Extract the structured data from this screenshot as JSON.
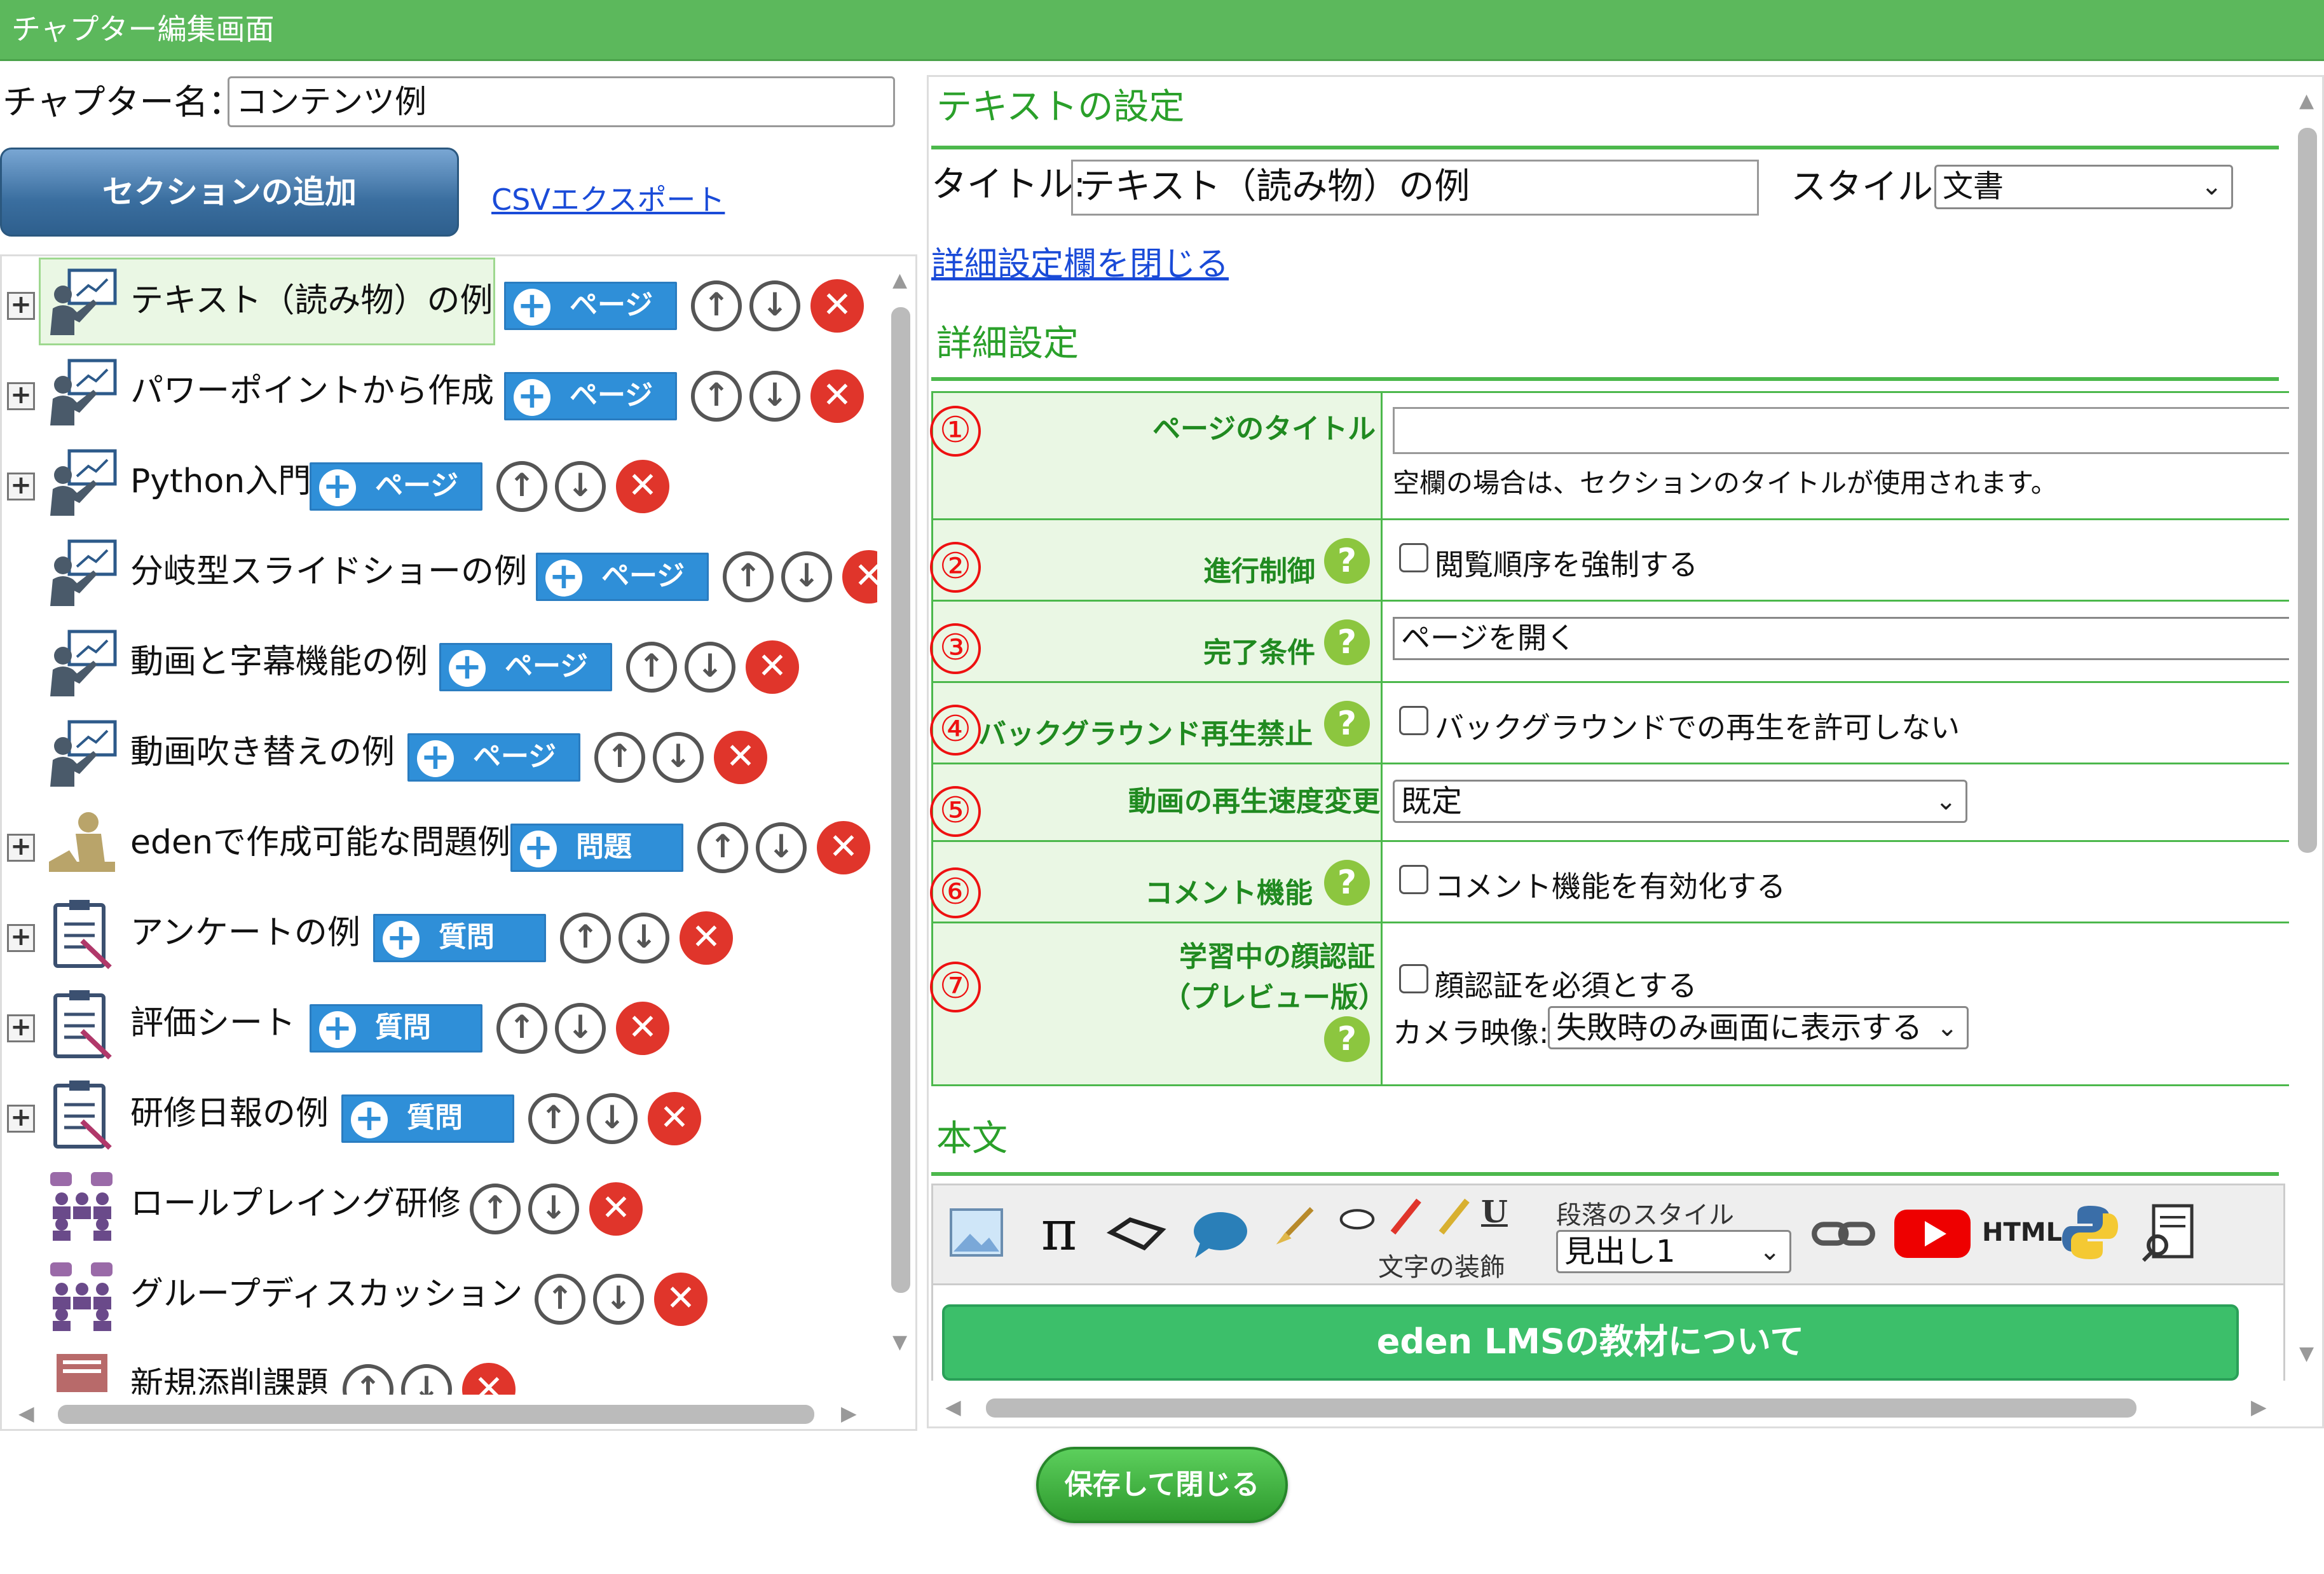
{
  "window_title": "チャプター編集画面",
  "chapter": {
    "label": "チャプター名：",
    "value": "コンテンツ例"
  },
  "toolbar": {
    "add_section_label": "セクションの追加",
    "csv_export_label": "CSVエクスポート"
  },
  "sections": [
    {
      "label": "テキスト（読み物）の例",
      "button": "ページ",
      "icon": "presentation-icon",
      "expandable": true,
      "selected": true,
      "has_button": true
    },
    {
      "label": "パワーポイントから作成",
      "button": "ページ",
      "icon": "presentation-icon",
      "expandable": true,
      "selected": false,
      "has_button": true
    },
    {
      "label": "Python入門",
      "button": "ページ",
      "icon": "presentation-icon",
      "expandable": true,
      "selected": false,
      "has_button": true
    },
    {
      "label": "分岐型スライドショーの例",
      "button": "ページ",
      "icon": "presentation-icon",
      "expandable": false,
      "selected": false,
      "has_button": true
    },
    {
      "label": "動画と字幕機能の例",
      "button": "ページ",
      "icon": "presentation-icon",
      "expandable": false,
      "selected": false,
      "has_button": true
    },
    {
      "label": "動画吹き替えの例",
      "button": "ページ",
      "icon": "presentation-icon",
      "expandable": false,
      "selected": false,
      "has_button": true
    },
    {
      "label": "edenで作成可能な問題例",
      "button": "問題",
      "icon": "exam-icon",
      "expandable": true,
      "selected": false,
      "has_button": true
    },
    {
      "label": "アンケートの例",
      "button": "質問",
      "icon": "clipboard-icon",
      "expandable": true,
      "selected": false,
      "has_button": true
    },
    {
      "label": "評価シート",
      "button": "質問",
      "icon": "clipboard-icon",
      "expandable": true,
      "selected": false,
      "has_button": true
    },
    {
      "label": "研修日報の例",
      "button": "質問",
      "icon": "clipboard-icon",
      "expandable": true,
      "selected": false,
      "has_button": true
    },
    {
      "label": "ロールプレイング研修",
      "button": "",
      "icon": "group-icon",
      "expandable": false,
      "selected": false,
      "has_button": false
    },
    {
      "label": "グループディスカッション",
      "button": "",
      "icon": "group-icon",
      "expandable": false,
      "selected": false,
      "has_button": false
    },
    {
      "label": "新規添削課題",
      "button": "",
      "icon": "report-icon",
      "expandable": false,
      "selected": false,
      "has_button": false
    }
  ],
  "text_settings": {
    "heading": "テキストの設定",
    "title_label": "タイトル:",
    "title_value": "テキスト（読み物）の例",
    "style_label": "スタイル:",
    "style_value": "文書",
    "close_detail_link": "詳細設定欄を閉じる"
  },
  "detail": {
    "heading": "詳細設定",
    "rows": [
      {
        "num": "①",
        "label": "ページのタイトル",
        "help": false,
        "note": "空欄の場合は、セクションのタイトルが使用されます。"
      },
      {
        "num": "②",
        "label": "進行制御",
        "help": true,
        "checkbox": "閲覧順序を強制する"
      },
      {
        "num": "③",
        "label": "完了条件",
        "help": true,
        "value": "ページを開く"
      },
      {
        "num": "④",
        "label": "バックグラウンド再生禁止",
        "help": true,
        "checkbox": "バックグラウンドでの再生を許可しない"
      },
      {
        "num": "⑤",
        "label": "動画の再生速度変更",
        "help": false,
        "select": "既定"
      },
      {
        "num": "⑥",
        "label": "コメント機能",
        "help": true,
        "checkbox": "コメント機能を有効化する"
      },
      {
        "num": "⑦",
        "label": "学習中の顔認証",
        "label2": "（プレビュー版）",
        "help": true,
        "checkbox": "顔認証を必須とする",
        "camera_label": "カメラ映像:",
        "camera_value": "失敗時のみ画面に表示する"
      }
    ]
  },
  "content": {
    "heading": "本文",
    "char_decoration_label": "文字の装飾",
    "paragraph_style_label": "段落のスタイル",
    "paragraph_style_value": "見出し1",
    "underline_glyph": "U",
    "pi_glyph": "π",
    "html_glyph": "HTML",
    "editor_heading": "eden LMSの教材について"
  },
  "colors": {
    "title_bar": "#5cb85c",
    "accent_green": "#2aa02a",
    "add_button": "#2f8fd8",
    "delete": "#e0352b",
    "link": "#1a4bd8"
  },
  "save_button": "保存して閉じる"
}
